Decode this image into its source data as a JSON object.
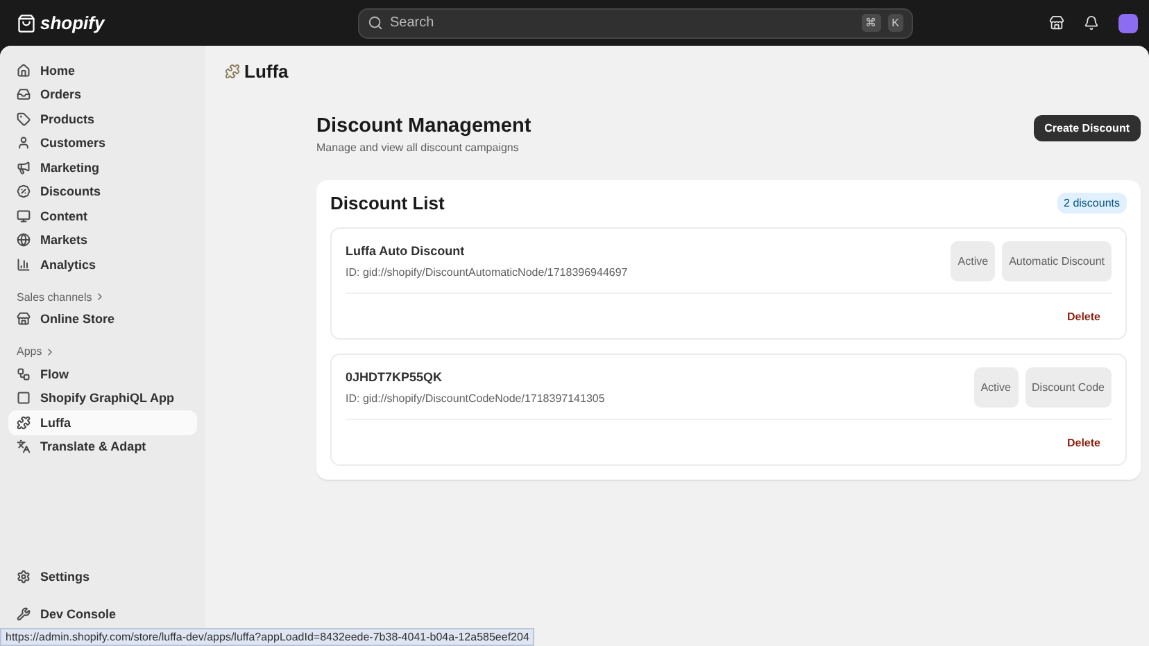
{
  "topbar": {
    "logo": "shopify",
    "search": {
      "placeholder": "Search",
      "keys": [
        "⌘",
        "K"
      ]
    }
  },
  "sidebar": {
    "main": [
      {
        "label": "Home",
        "selected": false
      },
      {
        "label": "Orders",
        "selected": false
      },
      {
        "label": "Products",
        "selected": false
      },
      {
        "label": "Customers",
        "selected": false
      },
      {
        "label": "Marketing",
        "selected": false
      },
      {
        "label": "Discounts",
        "selected": false
      },
      {
        "label": "Content",
        "selected": false
      },
      {
        "label": "Markets",
        "selected": false
      },
      {
        "label": "Analytics",
        "selected": false
      }
    ],
    "sales_channels": {
      "heading": "Sales channels",
      "items": [
        {
          "label": "Online Store",
          "selected": false
        }
      ]
    },
    "apps": {
      "heading": "Apps",
      "items": [
        {
          "label": "Flow",
          "selected": false
        },
        {
          "label": "Shopify GraphiQL App",
          "selected": false
        },
        {
          "label": "Luffa",
          "selected": true
        },
        {
          "label": "Translate & Adapt",
          "selected": false
        }
      ]
    },
    "footer": [
      {
        "label": "Settings",
        "selected": false
      },
      {
        "label": "Dev Console",
        "selected": false
      }
    ]
  },
  "app_title": "Luffa",
  "page": {
    "title": "Discount Management",
    "subtitle": "Manage and view all discount campaigns",
    "create_button": "Create Discount"
  },
  "list": {
    "title": "Discount List",
    "count": "2 discounts",
    "discounts": [
      {
        "name": "Luffa Auto Discount",
        "id": "ID: gid://shopify/DiscountAutomaticNode/1718396944697",
        "status": "Active",
        "type": "Automatic Discount",
        "delete": "Delete"
      },
      {
        "name": "0JHDT7KP55QK",
        "id": "ID: gid://shopify/DiscountCodeNode/1718397141305",
        "status": "Active",
        "type": "Discount Code",
        "delete": "Delete"
      }
    ]
  },
  "status_bar": "https://admin.shopify.com/store/luffa-dev/apps/luffa?appLoadId=8432eede-7b38-4041-b04a-12a585eef204"
}
